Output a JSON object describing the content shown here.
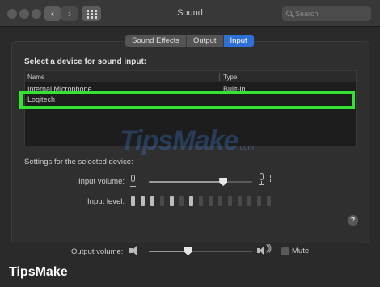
{
  "window": {
    "title": "Sound"
  },
  "search": {
    "placeholder": "Search"
  },
  "tabs": [
    {
      "label": "Sound Effects",
      "active": false
    },
    {
      "label": "Output",
      "active": false
    },
    {
      "label": "Input",
      "active": true
    }
  ],
  "input": {
    "heading": "Select a device for sound input:",
    "columns": {
      "name": "Name",
      "type": "Type"
    },
    "devices": [
      {
        "name": "Internal Microphone",
        "type": "Built-in"
      },
      {
        "name": "Logitech",
        "type": ""
      }
    ],
    "highlight_color": "#35e335",
    "settings_label": "Settings for the selected device:",
    "input_volume_label": "Input volume:",
    "input_volume": 0.72,
    "input_level_label": "Input level:",
    "input_level_segments_on": [
      1,
      2,
      3,
      5,
      7
    ],
    "input_level_segments_total": 15
  },
  "help": {
    "symbol": "?"
  },
  "output": {
    "volume_label": "Output volume:",
    "volume": 0.38,
    "mute_label": "Mute",
    "muted": false
  },
  "watermark": {
    "text": "TipsMake",
    "suffix": ".com"
  },
  "brand": {
    "text": "TipsMake"
  },
  "colors": {
    "accent": "#2f6fd8",
    "highlight": "#35e335"
  }
}
